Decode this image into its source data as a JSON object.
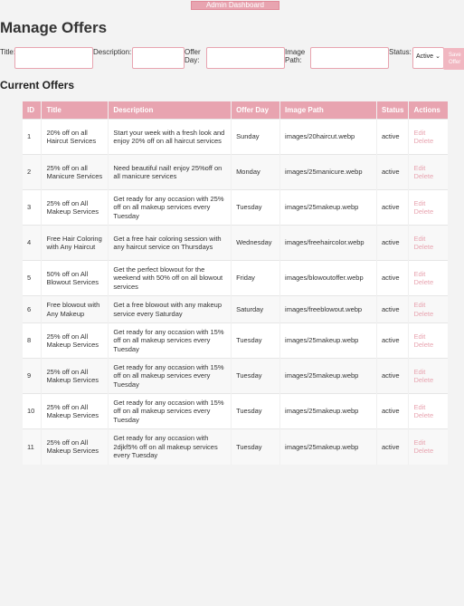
{
  "nav": {
    "admin_dashboard": "Admin Dashboard"
  },
  "page_title": "Manage Offers",
  "form": {
    "title_label": "Title:",
    "description_label": "Description:",
    "offer_day_label_1": "Offer",
    "offer_day_label_2": "Day:",
    "image_path_label_1": "Image",
    "image_path_label_2": "Path:",
    "status_label": "Status:",
    "status_value": "Active",
    "save_label_1": "Save",
    "save_label_2": "Offer"
  },
  "section_title": "Current Offers",
  "table": {
    "headers": [
      "ID",
      "Title",
      "Description",
      "Offer Day",
      "Image Path",
      "Status",
      "Actions"
    ],
    "edit_label": "Edit",
    "delete_label": "Delete",
    "rows": [
      {
        "id": "1",
        "title": "20% off on all Haircut Services",
        "description": "Start your week with a fresh look and enjoy 20% off on all haircut services",
        "day": "Sunday",
        "image": "images/20haircut.webp",
        "status": "active"
      },
      {
        "id": "2",
        "title": "25% off on all Manicure Services",
        "description": "Need beautiful nail! enjoy 25%off on all manicure services",
        "day": "Monday",
        "image": "images/25manicure.webp",
        "status": "active"
      },
      {
        "id": "3",
        "title": "25% off on All Makeup Services",
        "description": "Get ready for any occasion with 25% off on all makeup services every Tuesday",
        "day": "Tuesday",
        "image": "images/25makeup.webp",
        "status": "active"
      },
      {
        "id": "4",
        "title": "Free Hair Coloring with Any Haircut",
        "description": "Get a free hair coloring session with any haircut service on Thursdays",
        "day": "Wednesday",
        "image": "images/freehaircolor.webp",
        "status": "active"
      },
      {
        "id": "5",
        "title": "50% off on All Blowout Services",
        "description": "Get the perfect blowout for the weekend with 50% off on all blowout services",
        "day": "Friday",
        "image": "images/blowoutoffer.webp",
        "status": "active"
      },
      {
        "id": "6",
        "title": "Free blowout with Any Makeup",
        "description": "Get a free blowout with any makeup service every Saturday",
        "day": "Saturday",
        "image": "images/freeblowout.webp",
        "status": "active"
      },
      {
        "id": "8",
        "title": "25% off on All Makeup Services",
        "description": "Get ready for any occasion with 15% off on all makeup services every Tuesday",
        "day": "Tuesday",
        "image": "images/25makeup.webp",
        "status": "active"
      },
      {
        "id": "9",
        "title": "25% off on All Makeup Services",
        "description": "Get ready for any occasion with 15% off on all makeup services every Tuesday",
        "day": "Tuesday",
        "image": "images/25makeup.webp",
        "status": "active"
      },
      {
        "id": "10",
        "title": "25% off on All Makeup Services",
        "description": "Get ready for any occasion with 15% off on all makeup services every Tuesday",
        "day": "Tuesday",
        "image": "images/25makeup.webp",
        "status": "active"
      },
      {
        "id": "11",
        "title": "25% off on All Makeup Services",
        "description": "Get ready for any occasion with 2djkf5% off on all makeup services every Tuesday",
        "day": "Tuesday",
        "image": "images/25makeup.webp",
        "status": "active"
      }
    ]
  }
}
